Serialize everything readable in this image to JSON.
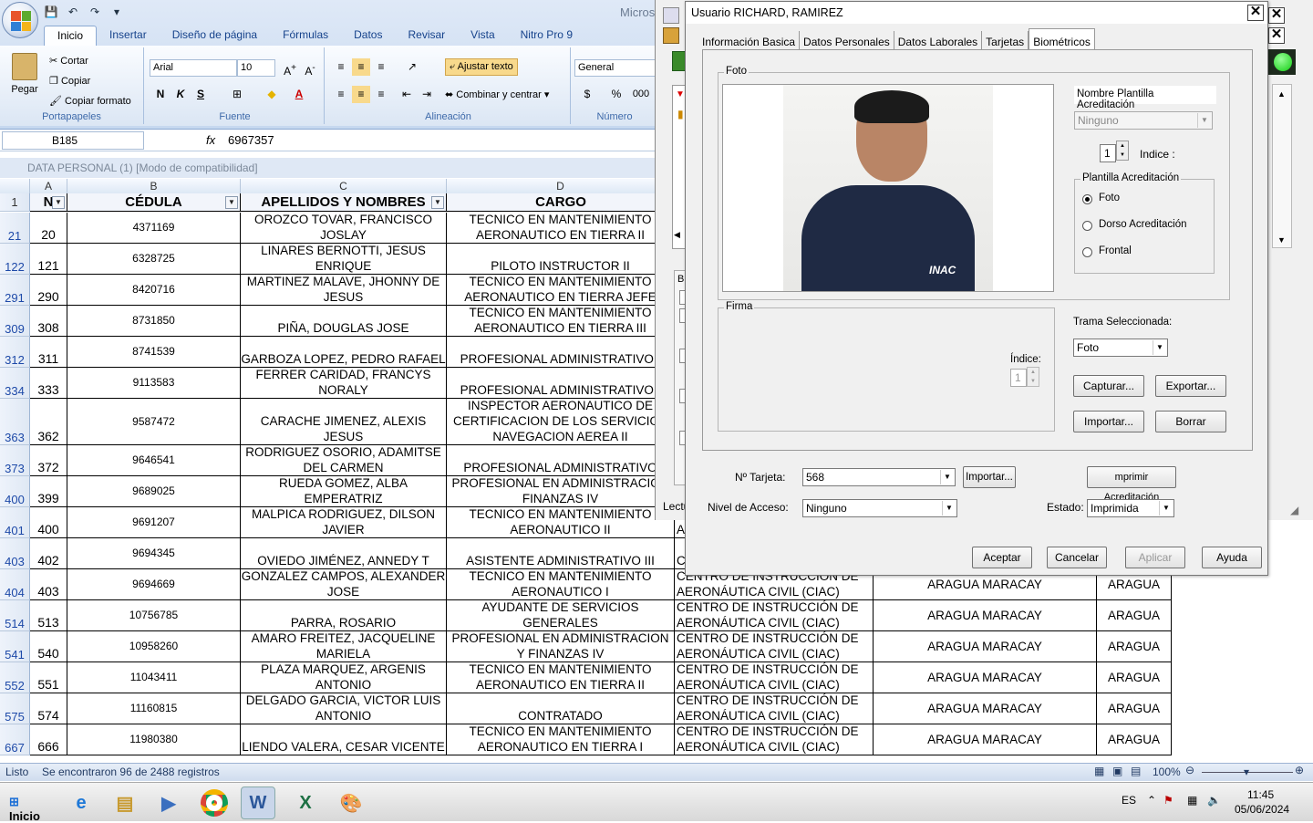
{
  "excel": {
    "app_title": "Micros",
    "tabs": [
      "Inicio",
      "Insertar",
      "Diseño de página",
      "Fórmulas",
      "Datos",
      "Revisar",
      "Vista",
      "Nitro Pro 9"
    ],
    "clipboard": {
      "paste": "Pegar",
      "cut": "Cortar",
      "copy": "Copiar",
      "format_painter": "Copiar formato",
      "label": "Portapapeles"
    },
    "font": {
      "name": "Arial",
      "size": "10",
      "label": "Fuente",
      "bold": "N",
      "italic": "K",
      "underline": "S"
    },
    "alignment": {
      "wrap": "Ajustar texto",
      "merge": "Combinar y centrar",
      "label": "Alineación"
    },
    "number": {
      "format": "General",
      "percent": "%",
      "thousands": "000",
      "label": "Número"
    },
    "name_box": "B185",
    "fx": "fx",
    "formula_value": "6967357",
    "doc_title": "DATA PERSONAL (1)  [Modo de compatibilidad]",
    "columns": [
      "A",
      "B",
      "C",
      "D"
    ],
    "header_row_number": "1",
    "headers": {
      "n": "N",
      "cedula": "CÉDULA",
      "apellidos": "APELLIDOS Y NOMBRES",
      "cargo": "CARGO"
    },
    "rows": [
      {
        "rn": "21",
        "n": "20",
        "ced": "4371169",
        "name": "OROZCO TOVAR, FRANCISCO JOSLAY",
        "cargo": "TECNICO EN MANTENIMIENTO AERONAUTICO EN TIERRA II",
        "centro": "",
        "ciudad": "",
        "estado": ""
      },
      {
        "rn": "122",
        "n": "121",
        "ced": "6328725",
        "name": "LINARES BERNOTTI, JESUS ENRIQUE",
        "cargo": "PILOTO INSTRUCTOR II",
        "centro": "",
        "ciudad": "",
        "estado": ""
      },
      {
        "rn": "291",
        "n": "290",
        "ced": "8420716",
        "name": "MARTINEZ MALAVE, JHONNY DE JESUS",
        "cargo": "TECNICO EN MANTENIMIENTO AERONAUTICO EN TIERRA JEFE",
        "centro": "",
        "ciudad": "",
        "estado": ""
      },
      {
        "rn": "309",
        "n": "308",
        "ced": "8731850",
        "name": "PIÑA, DOUGLAS JOSE",
        "cargo": "TECNICO EN MANTENIMIENTO AERONAUTICO EN TIERRA III",
        "centro": "",
        "ciudad": "",
        "estado": ""
      },
      {
        "rn": "312",
        "n": "311",
        "ced": "8741539",
        "name": "GARBOZA LOPEZ, PEDRO RAFAEL",
        "cargo": "PROFESIONAL ADMINISTRATIVO I",
        "centro": "",
        "ciudad": "",
        "estado": ""
      },
      {
        "rn": "334",
        "n": "333",
        "ced": "9113583",
        "name": "FERRER CARIDAD, FRANCYS NORALY",
        "cargo": "PROFESIONAL ADMINISTRATIVO I",
        "centro": "",
        "ciudad": "",
        "estado": ""
      },
      {
        "rn": "363",
        "n": "362",
        "ced": "9587472",
        "name": "CARACHE JIMENEZ, ALEXIS JESUS",
        "cargo": "INSPECTOR AERONAUTICO DE CERTIFICACION DE LOS SERVICIOS NAVEGACION AEREA II",
        "centro": "",
        "ciudad": "",
        "estado": ""
      },
      {
        "rn": "373",
        "n": "372",
        "ced": "9646541",
        "name": "RODRIGUEZ OSORIO, ADAMITSE DEL CARMEN",
        "cargo": "PROFESIONAL ADMINISTRATIVO",
        "centro": "",
        "ciudad": "",
        "estado": ""
      },
      {
        "rn": "400",
        "n": "399",
        "ced": "9689025",
        "name": "RUEDA GOMEZ, ALBA EMPERATRIZ",
        "cargo": "PROFESIONAL EN ADMINISTRACION FINANZAS IV",
        "centro": "",
        "ciudad": "",
        "estado": ""
      },
      {
        "rn": "401",
        "n": "400",
        "ced": "9691207",
        "name": "MALPICA RODRIGUEZ, DILSON JAVIER",
        "cargo": "TECNICO EN MANTENIMIENTO AERONAUTICO II",
        "centro": "A",
        "ciudad": "",
        "estado": ""
      },
      {
        "rn": "403",
        "n": "402",
        "ced": "9694345",
        "name": "OVIEDO JIMÉNEZ, ANNEDY T",
        "cargo": "ASISTENTE ADMINISTRATIVO III",
        "centro": "C A",
        "ciudad": "",
        "estado": ""
      },
      {
        "rn": "404",
        "n": "403",
        "ced": "9694669",
        "name": "GONZALEZ CAMPOS, ALEXANDER JOSE",
        "cargo": "TECNICO EN MANTENIMIENTO AERONAUTICO I",
        "centro": "CENTRO DE INSTRUCCIÓN DE AERONÁUTICA CIVIL (CIAC)",
        "ciudad": "ARAGUA MARACAY",
        "estado": "ARAGUA"
      },
      {
        "rn": "514",
        "n": "513",
        "ced": "10756785",
        "name": "PARRA, ROSARIO",
        "cargo": "AYUDANTE DE SERVICIOS GENERALES",
        "centro": "CENTRO DE INSTRUCCIÓN DE AERONÁUTICA CIVIL (CIAC)",
        "ciudad": "ARAGUA MARACAY",
        "estado": "ARAGUA"
      },
      {
        "rn": "541",
        "n": "540",
        "ced": "10958260",
        "name": "AMARO FREITEZ, JACQUELINE MARIELA",
        "cargo": "PROFESIONAL EN ADMINISTRACION Y FINANZAS IV",
        "centro": "CENTRO DE INSTRUCCIÓN DE AERONÁUTICA CIVIL (CIAC)",
        "ciudad": "ARAGUA MARACAY",
        "estado": "ARAGUA"
      },
      {
        "rn": "552",
        "n": "551",
        "ced": "11043411",
        "name": "PLAZA MARQUEZ, ARGENIS ANTONIO",
        "cargo": "TECNICO EN MANTENIMIENTO AERONAUTICO EN TIERRA II",
        "centro": "CENTRO DE INSTRUCCIÓN DE AERONÁUTICA CIVIL (CIAC)",
        "ciudad": "ARAGUA MARACAY",
        "estado": "ARAGUA"
      },
      {
        "rn": "575",
        "n": "574",
        "ced": "11160815",
        "name": "DELGADO GARCIA, VICTOR LUIS ANTONIO",
        "cargo": "CONTRATADO",
        "centro": "CENTRO DE INSTRUCCIÓN DE AERONÁUTICA CIVIL (CIAC)",
        "ciudad": "ARAGUA MARACAY",
        "estado": "ARAGUA"
      },
      {
        "rn": "667",
        "n": "666",
        "ced": "11980380",
        "name": "LIENDO VALERA, CESAR VICENTE",
        "cargo": "TECNICO EN MANTENIMIENTO AERONAUTICO EN TIERRA I",
        "centro": "CENTRO DE INSTRUCCIÓN DE AERONÁUTICA CIVIL (CIAC)",
        "ciudad": "ARAGUA MARACAY",
        "estado": "ARAGUA"
      }
    ],
    "status": "Listo",
    "status_records": "Se encontraron 96 de 2488 registros",
    "zoom": "100%"
  },
  "bgwin": {
    "label_lectura": "Lectu",
    "label_b": "B"
  },
  "dialog": {
    "title": "Usuario    RICHARD, RAMIREZ",
    "tabs": [
      "Información Basica",
      "Datos Personales",
      "Datos Laborales",
      "Tarjetas",
      "Biométricos"
    ],
    "foto_legend": "Foto",
    "photo_logo": "INAC",
    "plantilla_name_label": "Nombre Plantilla Acreditación",
    "plantilla_name_value": "Ninguno",
    "indice_label": "Indice :",
    "indice_value": "1",
    "plantilla_legend": "Plantilla Acreditación",
    "radio_foto": "Foto",
    "radio_dorso": "Dorso Acreditación",
    "radio_frontal": "Frontal",
    "firma_legend": "Firma",
    "firma_indice_label": "Índice:",
    "firma_indice_value": "1",
    "trama_label": "Trama Seleccionada:",
    "trama_value": "Foto",
    "btn_capturar": "Capturar...",
    "btn_exportar": "Exportar...",
    "btn_importar": "Importar...",
    "btn_borrar": "Borrar",
    "tarjeta_label": "Nº Tarjeta:",
    "tarjeta_value": "568",
    "btn_importar2": "Importar...",
    "btn_imprimir": "mprimir Acreditación",
    "nivel_label": "Nivel de Acceso:",
    "nivel_value": "Ninguno",
    "estado_label": "Estado:",
    "estado_value": "Imprimida",
    "btn_aceptar": "Aceptar",
    "btn_cancelar": "Cancelar",
    "btn_aplicar": "Aplicar",
    "btn_ayuda": "Ayuda"
  },
  "taskbar": {
    "start": "Inicio",
    "lang": "ES",
    "time": "11:45",
    "date": "05/06/2024"
  }
}
